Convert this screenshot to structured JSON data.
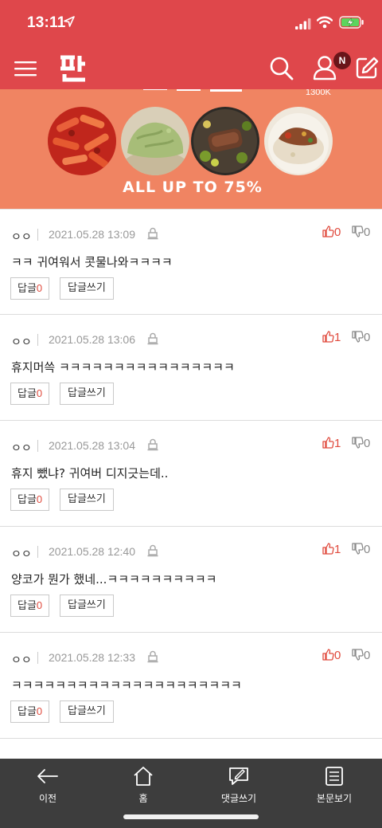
{
  "status_bar": {
    "time": "13:11"
  },
  "nav": {
    "logo_text": "판",
    "notification_badge": "N"
  },
  "banner": {
    "brand": "1300K",
    "headline": "ALL UP TO 75%"
  },
  "comments": [
    {
      "author": "ㅇㅇ",
      "date": "2021.05.28 13:09",
      "likes": "0",
      "dislikes": "0",
      "text": "ㅋㅋ 귀여워서 콧물나와ㅋㅋㅋㅋ",
      "reply_label": "답글",
      "reply_count": "0",
      "write_label": "답글쓰기"
    },
    {
      "author": "ㅇㅇ",
      "date": "2021.05.28 13:06",
      "likes": "1",
      "dislikes": "0",
      "text": "휴지머쓱 ㅋㅋㅋㅋㅋㅋㅋㅋㅋㅋㅋㅋㅋㅋㅋㅋ",
      "reply_label": "답글",
      "reply_count": "0",
      "write_label": "답글쓰기"
    },
    {
      "author": "ㅇㅇ",
      "date": "2021.05.28 13:04",
      "likes": "1",
      "dislikes": "0",
      "text": "휴지 뺐냐? 귀여버 디지긋는데..",
      "reply_label": "답글",
      "reply_count": "0",
      "write_label": "답글쓰기"
    },
    {
      "author": "ㅇㅇ",
      "date": "2021.05.28 12:40",
      "likes": "1",
      "dislikes": "0",
      "text": "양코가 뭔가 했네...ㅋㅋㅋㅋㅋㅋㅋㅋㅋㅋ",
      "reply_label": "답글",
      "reply_count": "0",
      "write_label": "답글쓰기"
    },
    {
      "author": "ㅇㅇ",
      "date": "2021.05.28 12:33",
      "likes": "0",
      "dislikes": "0",
      "text": "ㅋㅋㅋㅋㅋㅋㅋㅋㅋㅋㅋㅋㅋㅋㅋㅋㅋㅋㅋㅋㅋ",
      "reply_label": "답글",
      "reply_count": "0",
      "write_label": "답글쓰기"
    }
  ],
  "tabbar": {
    "prev": "이전",
    "home": "홈",
    "write_comment": "댓글쓰기",
    "view_article": "본문보기"
  },
  "colors": {
    "brand_red": "#df474b",
    "banner": "#f08462",
    "like_red": "#e04a3d",
    "tabbar": "#3d3d3d"
  }
}
